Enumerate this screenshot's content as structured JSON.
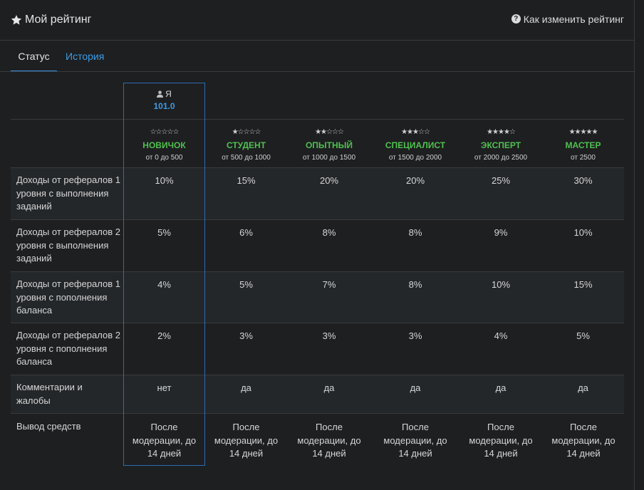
{
  "header": {
    "title": "Мой рейтинг",
    "help_label": "Как изменить рейтинг"
  },
  "tabs": [
    {
      "label": "Статус",
      "active": true
    },
    {
      "label": "История",
      "active": false
    }
  ],
  "me": {
    "label": "Я",
    "score": "101.0"
  },
  "levels": [
    {
      "name": "НОВИЧОК",
      "range": "от 0 до 500",
      "stars": "☆☆☆☆☆"
    },
    {
      "name": "СТУДЕНТ",
      "range": "от 500 до 1000",
      "stars": "★☆☆☆☆"
    },
    {
      "name": "ОПЫТНЫЙ",
      "range": "от 1000 до 1500",
      "stars": "★★☆☆☆"
    },
    {
      "name": "СПЕЦИАЛИСТ",
      "range": "от 1500 до 2000",
      "stars": "★★★☆☆"
    },
    {
      "name": "ЭКСПЕРТ",
      "range": "от 2000 до 2500",
      "stars": "★★★★☆"
    },
    {
      "name": "МАСТЕР",
      "range": "от 2500",
      "stars": "★★★★★"
    }
  ],
  "rows": [
    {
      "label": "Доходы от рефералов 1 уровня с выполнения заданий",
      "values": [
        "10%",
        "15%",
        "20%",
        "20%",
        "25%",
        "30%"
      ]
    },
    {
      "label": "Доходы от рефералов 2 уровня с выполнения заданий",
      "values": [
        "5%",
        "6%",
        "8%",
        "8%",
        "9%",
        "10%"
      ]
    },
    {
      "label": "Доходы от рефералов 1 уровня с пополнения баланса",
      "values": [
        "4%",
        "5%",
        "7%",
        "8%",
        "10%",
        "15%"
      ]
    },
    {
      "label": "Доходы от рефералов 2 уровня с пополнения баланса",
      "values": [
        "2%",
        "3%",
        "3%",
        "3%",
        "4%",
        "5%"
      ]
    },
    {
      "label": "Комментарии и жалобы",
      "values": [
        "нет",
        "да",
        "да",
        "да",
        "да",
        "да"
      ]
    },
    {
      "label": "Вывод средств",
      "values": [
        "После модерации, до 14 дней",
        "После модерации, до 14 дней",
        "После модерации, до 14 дней",
        "После модерации, до 14 дней",
        "После модерации, до 14 дней",
        "После модерации, до 14 дней"
      ]
    }
  ],
  "colors": {
    "accent": "#3a9de8",
    "level_name": "#4fc04f",
    "me_border": "#2d6cb5"
  }
}
